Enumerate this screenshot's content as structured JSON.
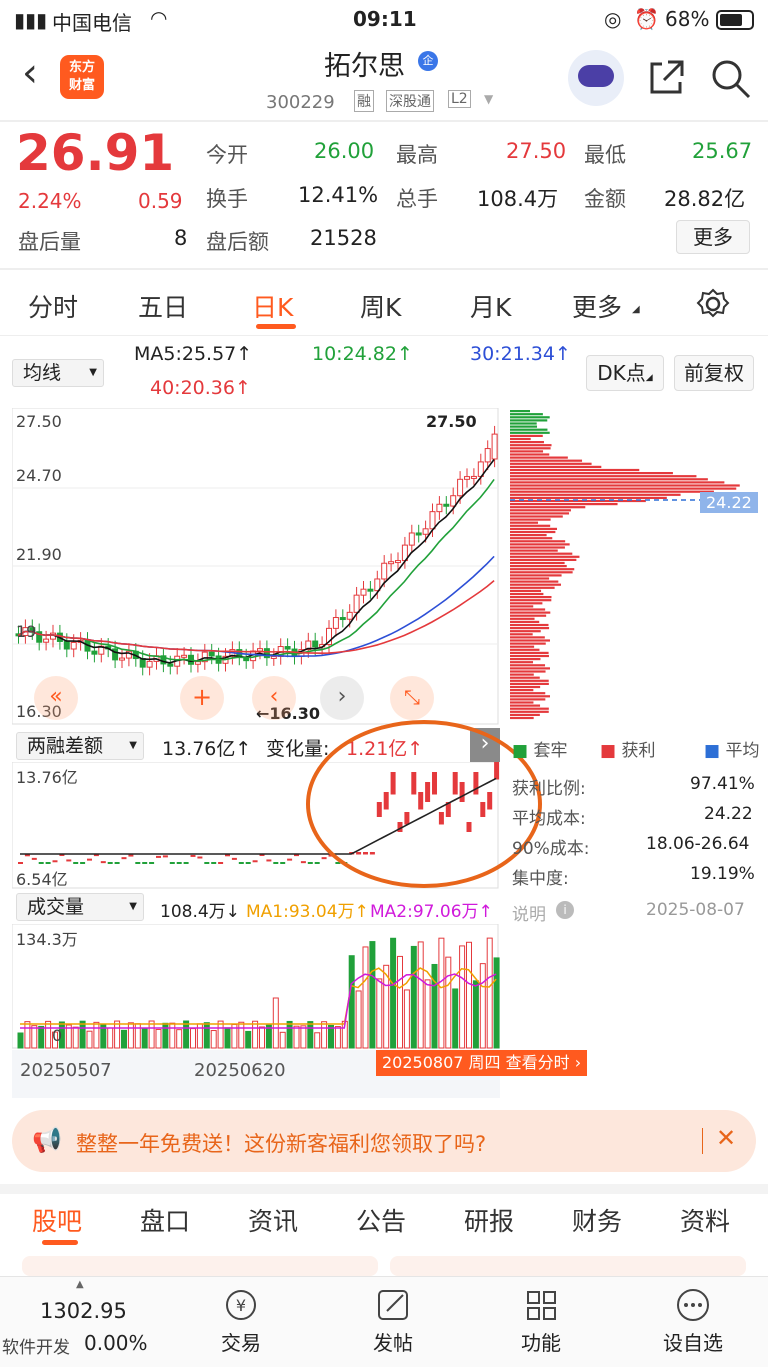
{
  "status": {
    "carrier": "中国电信",
    "time": "09:11",
    "battery": "68%"
  },
  "header": {
    "title": "拓尔思",
    "badge": "企",
    "code": "300229",
    "tags": [
      "融",
      "深股通",
      "L2"
    ],
    "app_logo": "东方\n财富"
  },
  "quote": {
    "price": "26.91",
    "pct": "2.24%",
    "chg": "0.59",
    "after_vol_label": "盘后量",
    "after_vol": "8",
    "open_label": "今开",
    "open": "26.00",
    "high_label": "最高",
    "high": "27.50",
    "low_label": "最低",
    "low": "25.67",
    "turn_label": "换手",
    "turn": "12.41%",
    "vol_label": "总手",
    "vol": "108.4万",
    "amt_label": "金额",
    "amt": "28.82亿",
    "after_amt_label": "盘后额",
    "after_amt": "21528",
    "more": "更多"
  },
  "tabs": [
    "分时",
    "五日",
    "日K",
    "周K",
    "月K",
    "更多"
  ],
  "ma": {
    "selector": "均线",
    "ma5": "MA5:25.57↑",
    "ma10": "10:24.82↑",
    "ma30": "30:21.34↑",
    "ma40": "40:20.36↑",
    "dk": "DK点",
    "adj": "前复权"
  },
  "kline": {
    "y1": "27.50",
    "y2": "24.70",
    "y3": "21.90",
    "y4": "19",
    "y5": "16.30",
    "hi_tag": "27.50",
    "lo_tag": "←16.30",
    "cost": "24.22"
  },
  "margin": {
    "selector": "两融差额",
    "value": "13.76亿↑",
    "change_label": "变化量:",
    "change": "1.21亿↑",
    "ymax": "13.76亿",
    "ymin": "6.54亿"
  },
  "chip": {
    "legend": [
      "套牢",
      "获利",
      "平均"
    ],
    "rows": [
      [
        "获利比例:",
        "97.41%"
      ],
      [
        "平均成本:",
        "24.22"
      ],
      [
        "90%成本:",
        "18.06-26.64"
      ],
      [
        "集中度:",
        "19.19%"
      ]
    ],
    "note": "说明",
    "date": "2025-08-07"
  },
  "volume": {
    "selector": "成交量",
    "value": "108.4万↓",
    "ma1": "MA1:93.04万↑",
    "ma2": "MA2:97.06万↑",
    "ymax": "134.3万",
    "ymin": "0",
    "d1": "20250507",
    "d2": "20250620",
    "cursor": "20250807 周四 查看分时"
  },
  "banner": {
    "text": "整整一年免费送！这份新客福利您领取了吗?"
  },
  "bottom_tabs": [
    "股吧",
    "盘口",
    "资讯",
    "公告",
    "研报",
    "财务",
    "资料"
  ],
  "footer": {
    "index": "1302.95",
    "sector": "软件开发",
    "sector_pct": "0.00%",
    "items": [
      "交易",
      "发帖",
      "功能",
      "设自选"
    ]
  },
  "colors": {
    "up": "#e4393c",
    "down": "#21a13a",
    "accent": "#ff5a1f"
  }
}
